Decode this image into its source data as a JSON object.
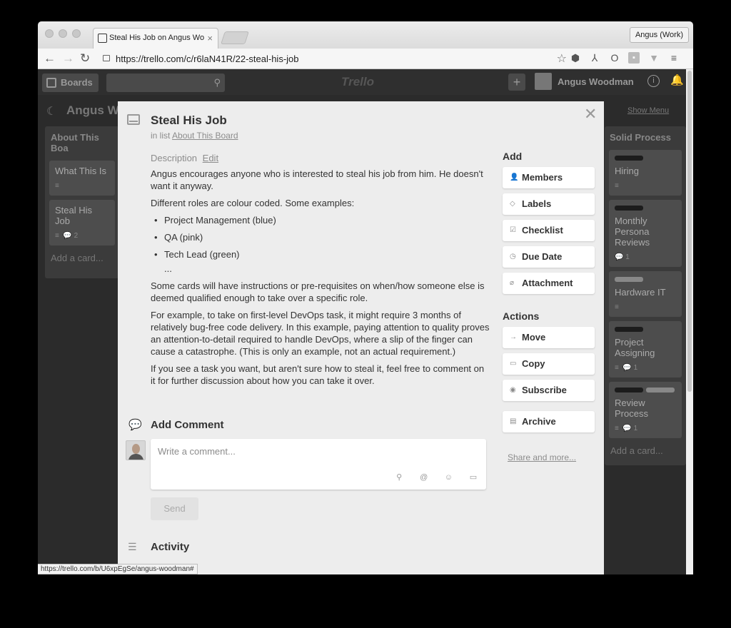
{
  "browser": {
    "tab_title": "Steal His Job on Angus Wo",
    "url": "https://trello.com/c/r6laN41R/22-steal-his-job",
    "profile": "Angus (Work)",
    "status_url": "https://trello.com/b/U6xpEgSe/angus-woodman#"
  },
  "trello": {
    "boards_label": "Boards",
    "logo": "Trello",
    "user_name": "Angus Woodman",
    "board_title": "Angus W",
    "show_menu": "Show Menu"
  },
  "left_list": {
    "title": "About This Boa",
    "cards": [
      {
        "title": "What This Is",
        "badges": ""
      },
      {
        "title": "Steal His Job",
        "badges": "2"
      }
    ],
    "add_card": "Add a card..."
  },
  "right_list": {
    "title": "Solid Process",
    "cards": [
      {
        "title": "Hiring",
        "badges": ""
      },
      {
        "title": "Monthly Persona Reviews",
        "badges": "1"
      },
      {
        "title": "Hardware IT",
        "badges": ""
      },
      {
        "title": "Project Assigning",
        "badges": "1"
      },
      {
        "title": "Review Process",
        "badges": "1"
      }
    ],
    "add_card": "Add a card..."
  },
  "card": {
    "title": "Steal His Job",
    "in_list_prefix": "in list",
    "in_list_name": "About This Board",
    "description_label": "Description",
    "edit_label": "Edit",
    "desc": {
      "p1": "Angus encourages anyone who is interested to steal his job from him. He doesn't want it anyway.",
      "p2": "Different roles are colour coded. Some examples:",
      "items": [
        "Project Management (blue)",
        "QA (pink)",
        "Tech Lead (green)"
      ],
      "ellipsis": "...",
      "p3": "Some cards will have instructions or pre-requisites on when/how someone else is deemed qualified enough to take over a specific role.",
      "p4": "For example, to take on first-level DevOps task, it might require 3 months of relatively bug-free code delivery. In this example, paying attention to quality proves an attention-to-detail required to handle DevOps, where a slip of the finger can cause a catastrophe. (This is only an example, not an actual requirement.)",
      "p5": "If you see a task you want, but aren't sure how to steal it, feel free to comment on it for further discussion about how you can take it over."
    },
    "add_comment_title": "Add Comment",
    "comment_placeholder": "Write a comment...",
    "send_label": "Send",
    "activity_title": "Activity"
  },
  "sidebar": {
    "add_heading": "Add",
    "add_buttons": [
      "Members",
      "Labels",
      "Checklist",
      "Due Date",
      "Attachment"
    ],
    "actions_heading": "Actions",
    "action_buttons": [
      "Move",
      "Copy",
      "Subscribe"
    ],
    "archive_label": "Archive",
    "share_more": "Share and more..."
  }
}
